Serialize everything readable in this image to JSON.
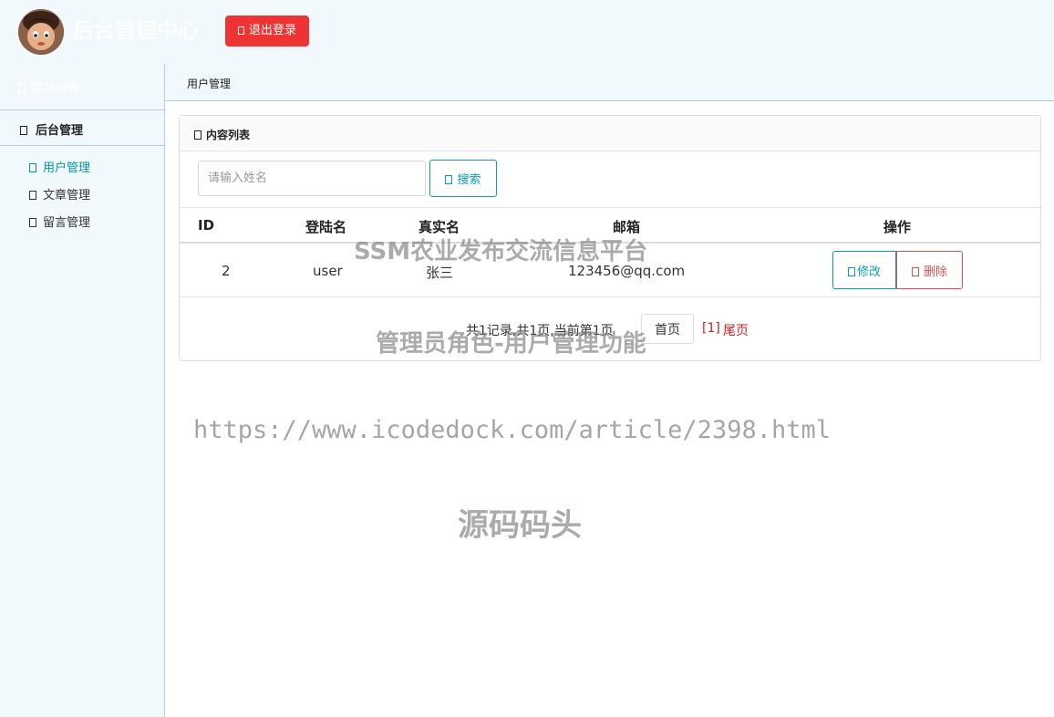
{
  "header": {
    "title": "后台管理中心",
    "logout_label": "退出登录",
    "logout_icon": "power-icon"
  },
  "sidebar": {
    "menu_title": "菜单列表",
    "group_label": "后台管理",
    "items": [
      {
        "label": "用户管理",
        "active": true
      },
      {
        "label": "文章管理",
        "active": false
      },
      {
        "label": "留言管理",
        "active": false
      }
    ]
  },
  "breadcrumb": {
    "current": "用户管理"
  },
  "panel": {
    "title": "内容列表",
    "search": {
      "placeholder": "请输入姓名",
      "button_label": "搜索"
    },
    "table": {
      "columns": [
        "ID",
        "登陆名",
        "真实名",
        "邮箱",
        "操作"
      ],
      "rows": [
        {
          "id": "2",
          "login": "user",
          "realname": "张三",
          "email": "123456@qq.com"
        }
      ],
      "edit_label": "修改",
      "delete_label": "删除"
    },
    "pager": {
      "summary": "共1记录,共1页,当前第1页",
      "first_label": "首页",
      "current_label": "[1]",
      "last_label": "尾页"
    }
  },
  "watermarks": {
    "line1": "SSM农业发布交流信息平台",
    "line2": "管理员角色-用户管理功能",
    "line3": "https://www.icodedock.com/article/2398.html",
    "line4": "源码码头"
  },
  "colors": {
    "accent": "#0a9fb0",
    "danger": "#ee3333",
    "background": "#f2f9fd"
  }
}
